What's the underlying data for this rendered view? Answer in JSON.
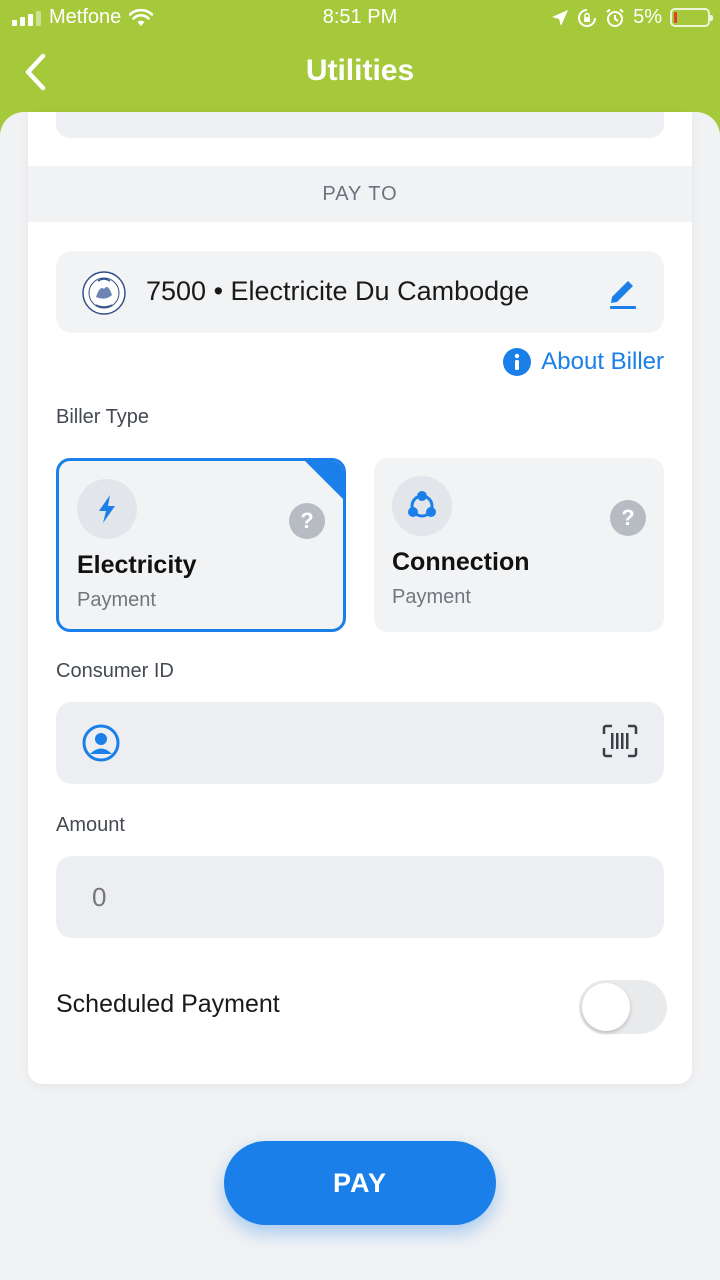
{
  "status_bar": {
    "carrier": "Metfone",
    "time": "8:51 PM",
    "battery": "5%",
    "icons": [
      "signal-icon",
      "wifi-icon",
      "location-icon",
      "rotation-lock-icon",
      "alarm-icon",
      "battery-icon"
    ]
  },
  "header": {
    "title": "Utilities",
    "back_icon": "chevron-left-icon",
    "background_color": "#a5c93a"
  },
  "pay_to": {
    "section_label": "PAY TO",
    "biller": {
      "text": "7500 • Electricite Du Cambodge",
      "logo": "edc-seal-logo",
      "edit_icon": "pencil-icon"
    },
    "about_biller": "About Biller"
  },
  "biller_type": {
    "label": "Biller Type",
    "options": [
      {
        "title": "Electricity",
        "subtitle": "Payment",
        "icon": "lightning-icon",
        "selected": true
      },
      {
        "title": "Connection",
        "subtitle": "Payment",
        "icon": "connection-icon",
        "selected": false
      }
    ]
  },
  "consumer_id": {
    "label": "Consumer ID",
    "value": "",
    "icon": "user-circle-icon",
    "scan_icon": "barcode-scan-icon"
  },
  "amount": {
    "label": "Amount",
    "placeholder": "0"
  },
  "scheduled_payment": {
    "label": "Scheduled Payment",
    "enabled": false
  },
  "pay_button": "PAY",
  "colors": {
    "accent": "#1a7fe8",
    "brand_green": "#a5c93a"
  }
}
